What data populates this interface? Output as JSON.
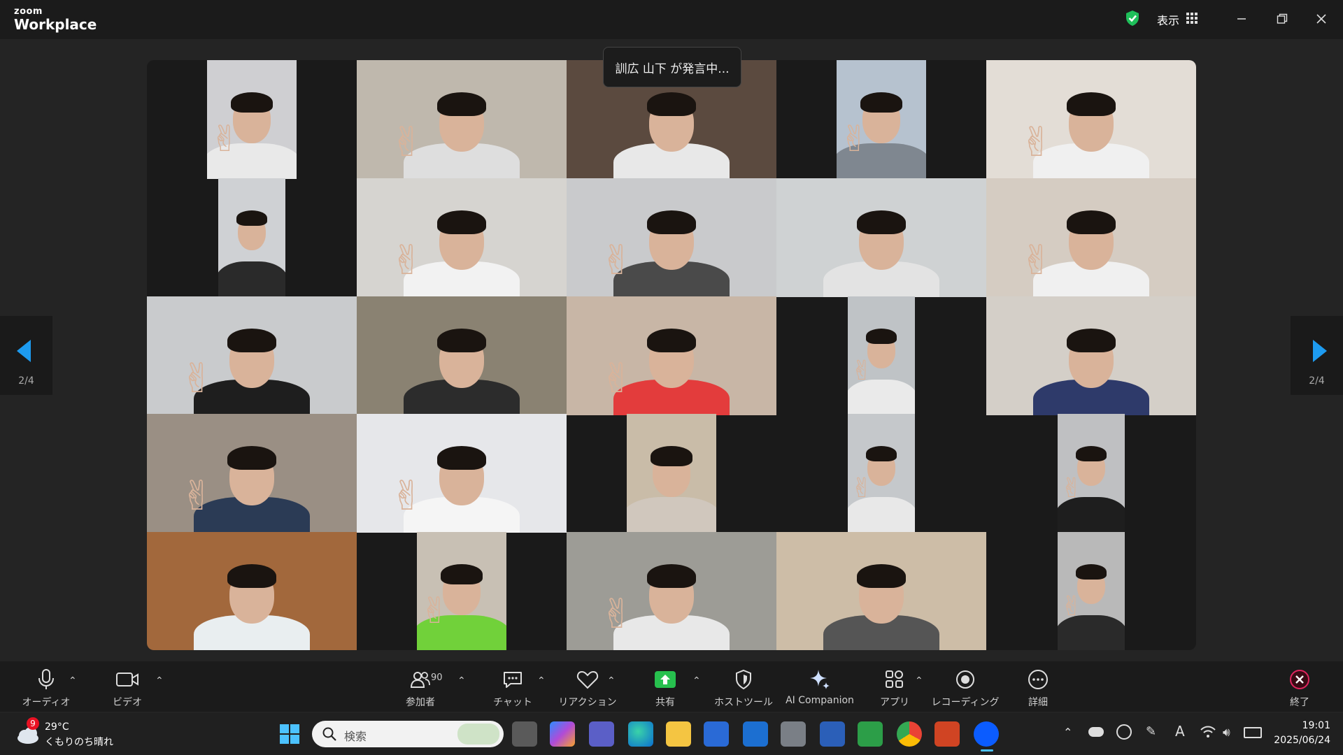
{
  "app": {
    "brand_small": "zoom",
    "brand_big": "Workplace"
  },
  "header": {
    "view_label": "表示"
  },
  "speaking": {
    "text": "訓広 山下 が発言中..."
  },
  "pager": {
    "left": "2/4",
    "right": "2/4"
  },
  "toolbar": {
    "audio": "オーディオ",
    "video": "ビデオ",
    "participants": "参加者",
    "participants_count": "90",
    "chat": "チャット",
    "reaction": "リアクション",
    "share": "共有",
    "host_tools": "ホストツール",
    "ai": "AI Companion",
    "apps": "アプリ",
    "recording": "レコーディング",
    "more": "詳細",
    "end": "終了"
  },
  "taskbar": {
    "weather_temp": "29°C",
    "weather_desc": "くもりのち晴れ",
    "weather_badge": "9",
    "search_placeholder": "検索",
    "time": "19:01",
    "date": "2025/06/24"
  },
  "colors": {
    "accent": "#0e72ed",
    "share_green": "#27c04e",
    "end_red": "#e0245e",
    "shield_green": "#1fbf5a"
  }
}
